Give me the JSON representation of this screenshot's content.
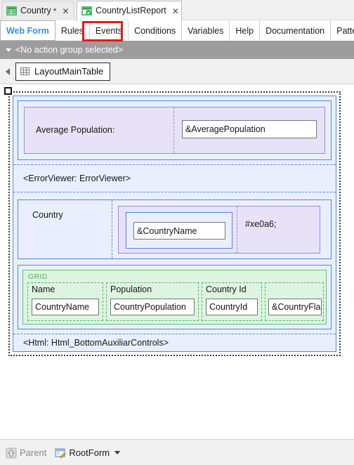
{
  "document_tabs": [
    {
      "label": "Country",
      "icon": "table-green-icon",
      "dirty": "*",
      "close": "✕",
      "active": false
    },
    {
      "label": "CountryListReport",
      "icon": "webpanel-green-icon",
      "dirty": "",
      "close": "✕",
      "active": true
    }
  ],
  "section_tabs": [
    {
      "label": "Web Form",
      "selected": true
    },
    {
      "label": "Rules",
      "selected": false
    },
    {
      "label": "Events",
      "selected": false
    },
    {
      "label": "Conditions",
      "selected": false
    },
    {
      "label": "Variables",
      "selected": false
    },
    {
      "label": "Help",
      "selected": false
    },
    {
      "label": "Documentation",
      "selected": false
    },
    {
      "label": "Patterns",
      "selected": false
    }
  ],
  "action_bar": {
    "text": "<No action group selected>",
    "caret_icon": "chevron-down-icon"
  },
  "crumb_bar": {
    "back_icon": "chevron-left-icon",
    "item_label": "LayoutMainTable",
    "item_icon": "table-grid-icon"
  },
  "canvas": {
    "average_population": {
      "label": "Average Population:",
      "value_control": "&AveragePopulation"
    },
    "error_viewer": {
      "label": "<ErrorViewer: ErrorViewer>"
    },
    "country_section": {
      "label": "Country",
      "name_control": "&CountryName",
      "flag_cell": "#xe0a6;"
    },
    "grid": {
      "title": "GRID",
      "columns": [
        {
          "header": "Name",
          "control": "CountryName"
        },
        {
          "header": "Population",
          "control": "CountryPopulation"
        },
        {
          "header": "Country Id",
          "control": "CountryId"
        },
        {
          "header": "",
          "control": "&CountryFlag"
        }
      ]
    },
    "bottom_html": {
      "label": "<Html: Html_BottomAuxiliarControls>"
    }
  },
  "status_bar": {
    "parent_icon": "up-arrow-icon",
    "parent_label": "Parent",
    "rootform_icon": "form-edit-icon",
    "rootform_label": "RootForm",
    "caret_icon": "chevron-down-icon"
  },
  "colors": {
    "accent_blue": "#3a90d4",
    "panel_blue_border": "#4f86e0",
    "panel_blue_fill": "#eaefff",
    "panel_purple_border": "#9b8ec8",
    "panel_purple_fill": "#e7e2f7",
    "grid_green_border": "#5fbf7a",
    "grid_green_fill": "#ddf5e0",
    "grid_label_green": "#4fb06b",
    "highlight_red": "#e81818",
    "action_bar_gray": "#9d9d9d"
  }
}
